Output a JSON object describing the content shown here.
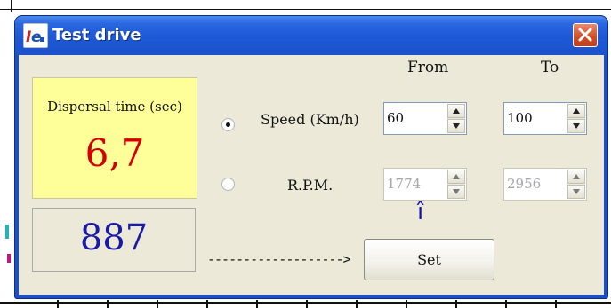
{
  "window": {
    "title": "Test drive",
    "icon": "app-icon"
  },
  "dispersal": {
    "label": "Dispersal time (sec)",
    "value": "6,7"
  },
  "counter": {
    "value": "887"
  },
  "columns": {
    "from": "From",
    "to": "To"
  },
  "rows": {
    "speed": {
      "label": "Speed (Km/h)",
      "selected": true,
      "from": "60",
      "to": "100",
      "enabled": true
    },
    "rpm": {
      "label": "R.P.M.",
      "selected": false,
      "from": "1774",
      "to": "2956",
      "enabled": false
    }
  },
  "indicator": "î",
  "arrow_text": "------------------->",
  "set_label": "Set",
  "colors": {
    "titlebar": "#1d58d6",
    "client_bg": "#ece9d8",
    "panel_yellow": "#ffff99",
    "value_red": "#d40000",
    "value_blue": "#1a1aa8"
  }
}
